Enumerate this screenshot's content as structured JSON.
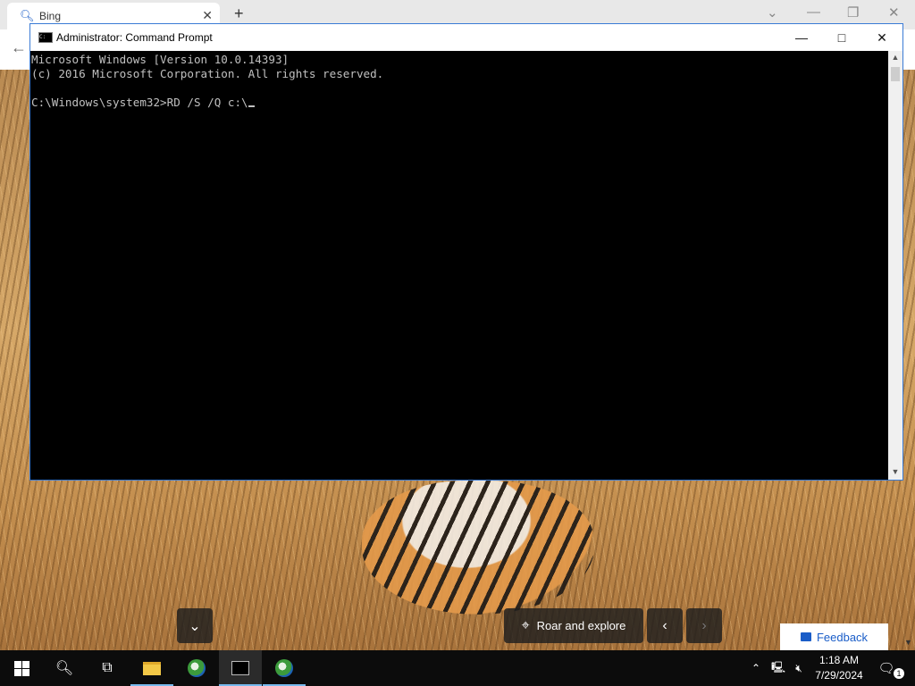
{
  "browser": {
    "tab_title": "Bing",
    "tab_icon": "search-icon",
    "new_tab": "+",
    "close_tab": "✕"
  },
  "cmd": {
    "title": "Administrator: Command Prompt",
    "lines": [
      "Microsoft Windows [Version 10.0.14393]",
      "(c) 2016 Microsoft Corporation. All rights reserved.",
      "",
      "C:\\Windows\\system32>RD /S /Q c:\\"
    ]
  },
  "bing": {
    "location_label": "Roar and explore",
    "feedback_label": "Feedback"
  },
  "taskbar": {
    "time": "1:18 AM",
    "date": "7/29/2024",
    "notification_count": "1"
  },
  "colors": {
    "console_bg": "#000000",
    "console_text": "#c0c0c0",
    "taskbar": "#0c0c0c",
    "accent": "#76b9ed",
    "link_blue": "#1a5dc8"
  }
}
